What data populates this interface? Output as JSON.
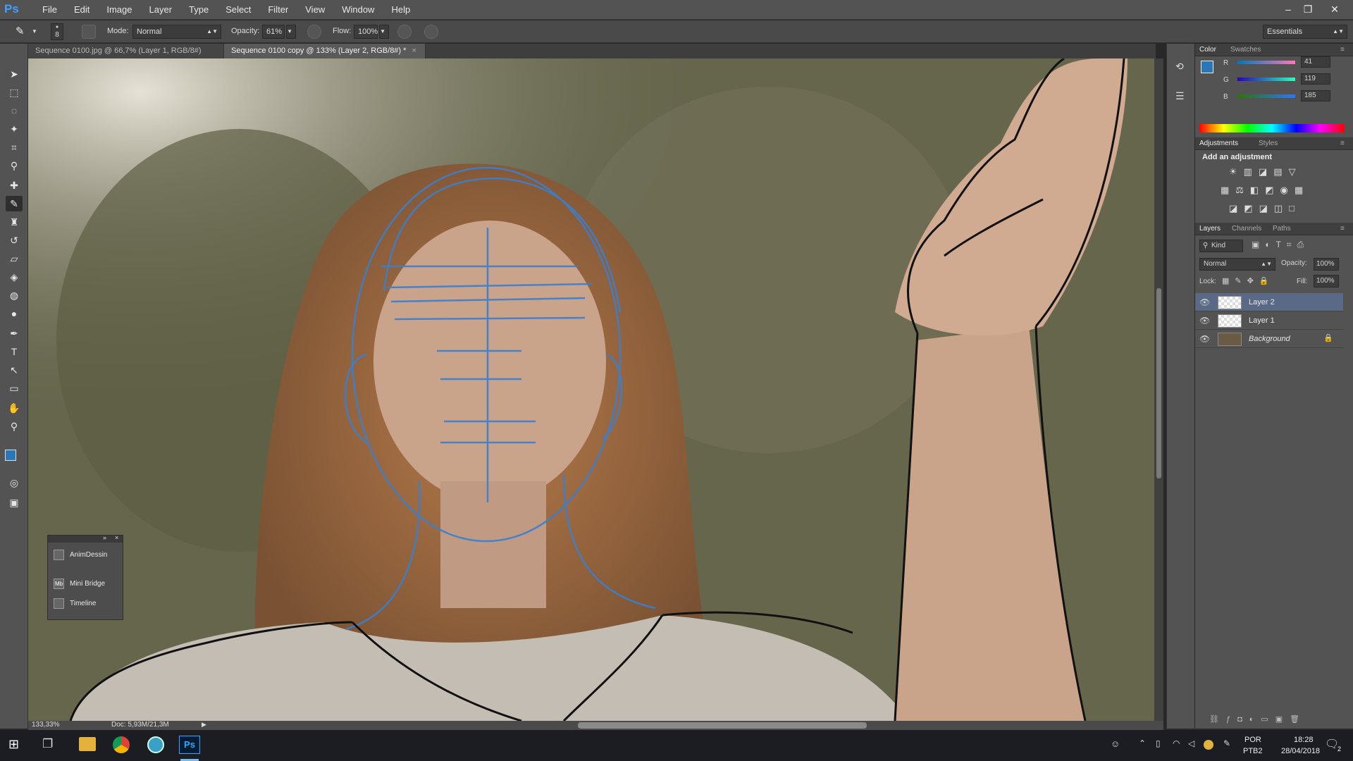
{
  "app": {
    "logo": "Ps"
  },
  "menu": [
    "File",
    "Edit",
    "Image",
    "Layer",
    "Type",
    "Select",
    "Filter",
    "View",
    "Window",
    "Help"
  ],
  "window_controls": {
    "minimize": "–",
    "restore": "❐",
    "close": "✕"
  },
  "options": {
    "brush_size": "8",
    "mode_label": "Mode:",
    "mode_value": "Normal",
    "opacity_label": "Opacity:",
    "opacity_value": "61%",
    "flow_label": "Flow:",
    "flow_value": "100%",
    "workspace": "Essentials"
  },
  "tabs": [
    {
      "label": "Sequence 0100.jpg @ 66,7% (Layer 1, RGB/8#) *",
      "close": "×"
    },
    {
      "label": "Sequence 0100 copy @ 133% (Layer 2, RGB/8#) *",
      "close": "×"
    }
  ],
  "status": {
    "zoom": "133,33%",
    "doc": "Doc: 5,93M/21,3M"
  },
  "color_panel": {
    "tabs": [
      "Color",
      "Swatches"
    ],
    "r_label": "R",
    "r_value": "41",
    "g_label": "G",
    "g_value": "119",
    "b_label": "B",
    "b_value": "185",
    "foreground": "#2977b9"
  },
  "adjustments_panel": {
    "tabs": [
      "Adjustments",
      "Styles"
    ],
    "heading": "Add an adjustment"
  },
  "layers_panel": {
    "tabs": [
      "Layers",
      "Channels",
      "Paths"
    ],
    "filter_kind": "Kind",
    "blend_mode": "Normal",
    "opacity_label": "Opacity:",
    "opacity_value": "100%",
    "lock_label": "Lock:",
    "fill_label": "Fill:",
    "fill_value": "100%",
    "layers": [
      {
        "name": "Layer 2",
        "selected": true
      },
      {
        "name": "Layer 1",
        "selected": false
      },
      {
        "name": "Background",
        "selected": false,
        "locked": true
      }
    ]
  },
  "float_panel": {
    "items": [
      "AnimDessin",
      "Mini Bridge",
      "Timeline"
    ],
    "icon_mb": "Mb"
  },
  "taskbar": {
    "lang_1": "POR",
    "lang_2": "PTB2",
    "time": "18:28",
    "date": "28/04/2018",
    "notif_count": "2",
    "ps_label": "Ps"
  },
  "colors": {
    "accent": "#3f8cd9",
    "sketch_blue": "#3a7fd0"
  }
}
